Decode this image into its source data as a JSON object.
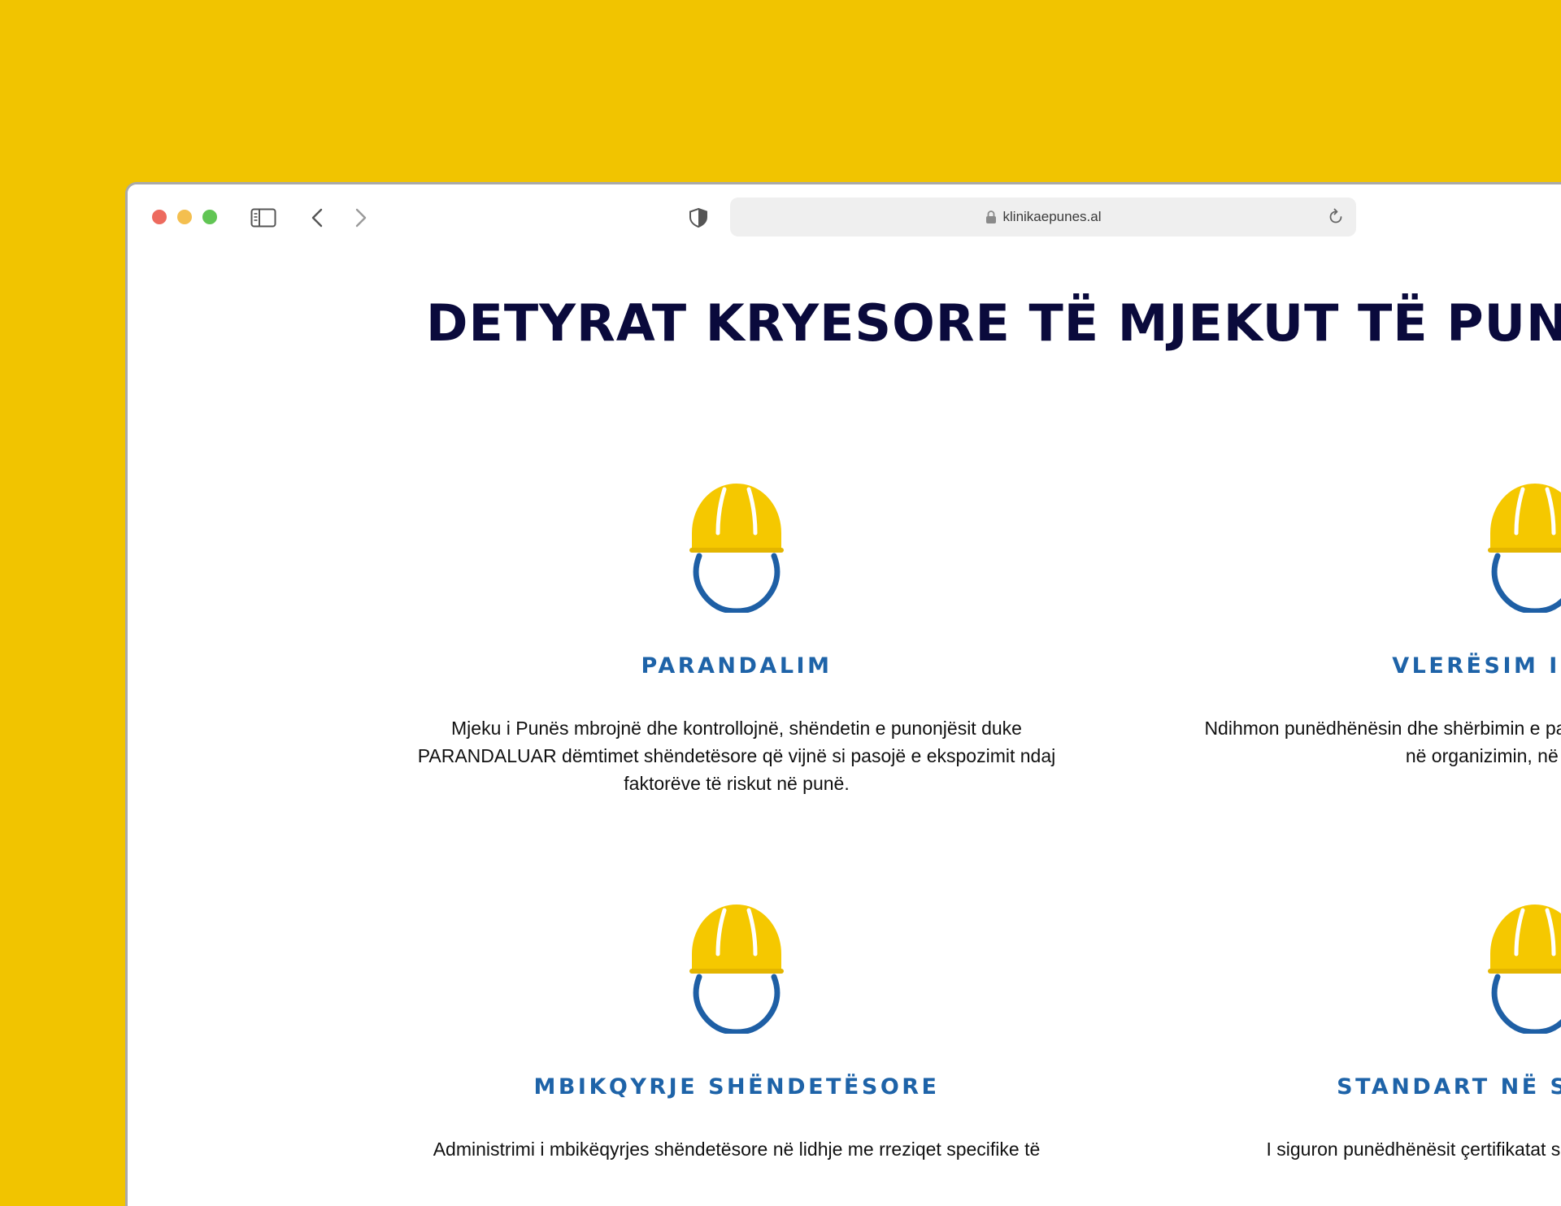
{
  "browser": {
    "url": "klinikaepunes.al",
    "icons": [
      "sidebar-icon",
      "back-icon",
      "forward-icon",
      "shield-icon",
      "lock-icon",
      "reload-icon"
    ]
  },
  "page": {
    "title": "DETYRAT KRYESORE TË MJEKUT TË PUNËS",
    "cards": [
      {
        "heading": "PARANDALIM",
        "text": "Mjeku i Punës mbrojnë dhe kontrollojnë, shëndetin e punonjësit duke PARANDALUAR dëmtimet shëndetësore që vijnë si pasojë e ekspozimit ndaj faktorëve të riskut në punë."
      },
      {
        "heading": "VLERËSIM I RISKUT",
        "text": "Ndihmon punëdhënësin dhe shërbimin e parandalimit në vlerësimin e rreziqeve, në organizimin, në mbikëqyrjen"
      },
      {
        "heading": "MBIKQYRJE SHËNDETËSORE",
        "text": "Administrimi i mbikëqyrjes shëndetësore në lidhje me rreziqet specifike të"
      },
      {
        "heading": "STANDART NË SHËNDETËSI",
        "text": "I siguron punëdhënësit çertifikatat shëndetësore duke respektuar"
      }
    ]
  },
  "colors": {
    "background": "#F1C400",
    "title": "#0A0A3C",
    "heading": "#1E63A8",
    "helmet": "#F5C800",
    "strap": "#1E5FA5"
  }
}
